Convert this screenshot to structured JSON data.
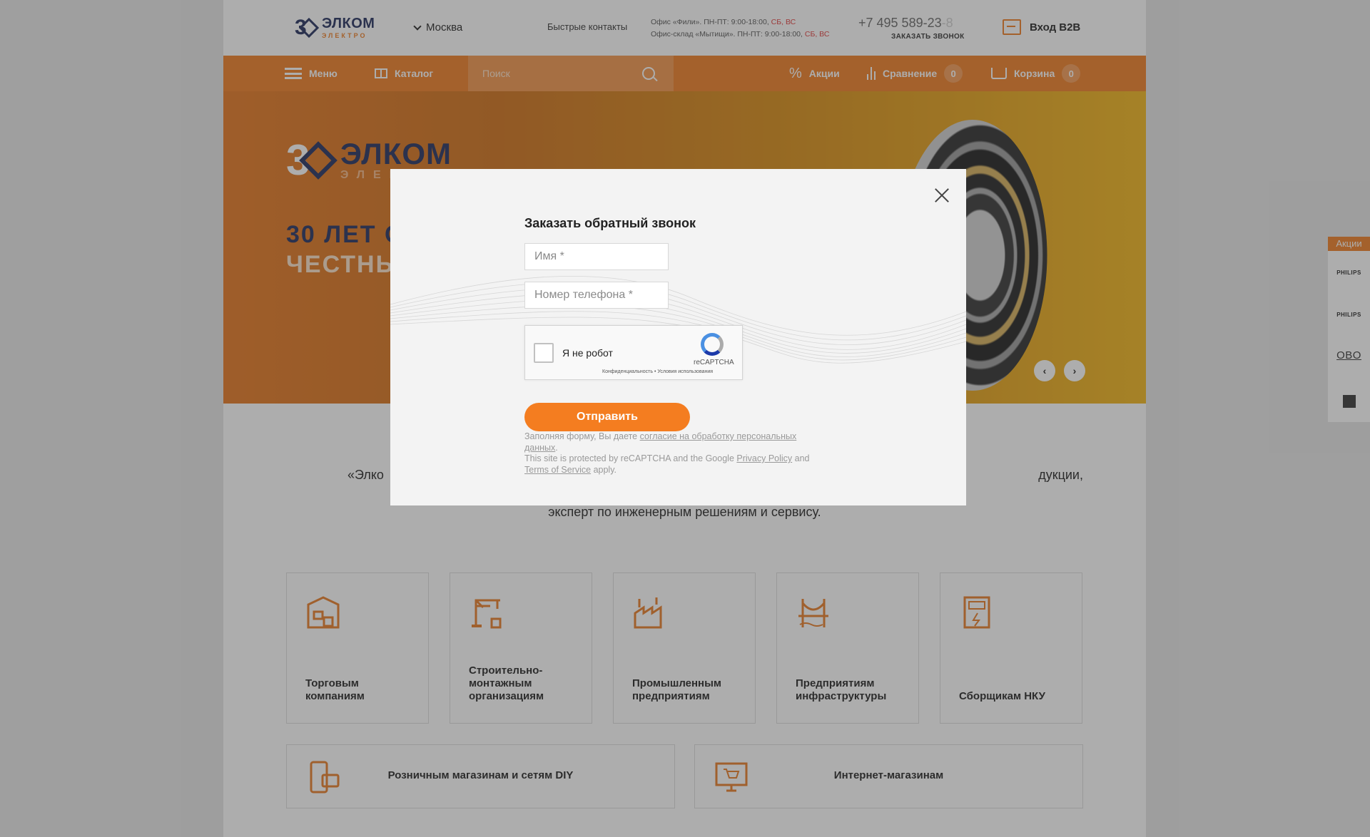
{
  "header": {
    "logo_main": "ЭЛКОМ",
    "logo_sub": "ЭЛЕКТРО",
    "logo_badge_num": "3",
    "city": "Москва",
    "quick_contacts": "Быстрые контакты",
    "office_1": "Офис «Фили». ПН-ПТ: 9:00-18:00,",
    "office_2": "Офис-склад «Мытищи». ПН-ПТ: 9:00-18:00,",
    "weekend": "СБ, ВС",
    "phone": "+7 495 589-23",
    "phone_fade": "-8",
    "callback": "ЗАКАЗАТЬ ЗВОНОК",
    "b2b": "Вход B2B"
  },
  "nav": {
    "menu": "Меню",
    "catalog": "Каталог",
    "search_placeholder": "Поиск",
    "promos": "Акции",
    "compare": "Сравнение",
    "compare_count": "0",
    "cart": "Корзина",
    "cart_count": "0"
  },
  "hero": {
    "logo_main": "ЭЛКОМ",
    "logo_sub": "ЭЛЕКТРО",
    "logo_badge_num": "3",
    "title_line1": "30 ЛЕТ С",
    "title_line2": "ЧЕСТНЫ"
  },
  "intro": {
    "line1_start": "«Элко",
    "line1_end": "дукции,",
    "line2": "эксперт по инженерным решениям и сервису."
  },
  "tiles": [
    {
      "label": "Торговым компаниям"
    },
    {
      "label": "Строительно-монтажным организациям"
    },
    {
      "label": "Промышленным предприятиям"
    },
    {
      "label": "Предприятиям инфраструктуры"
    },
    {
      "label": "Сборщикам НКУ"
    }
  ],
  "wide_tiles": [
    {
      "label": "Розничным магазинам и сетям DIY"
    },
    {
      "label": "Интернет-магазинам"
    }
  ],
  "promo_strip": {
    "label": "Акции",
    "brand1": "PHILIPS",
    "brand2": "PHILIPS",
    "brand3": "OBO"
  },
  "modal": {
    "title": "Заказать обратный звонок",
    "name_placeholder": "Имя *",
    "phone_placeholder": "Номер телефона *",
    "captcha_label": "Я не робот",
    "captcha_brand": "reCAPTCHA",
    "captcha_terms": "Конфиденциальность • Условия использования",
    "submit": "Отправить",
    "notice_1": "Заполняя форму, Вы даете",
    "notice_link": "согласие на обработку персональных данных",
    "notice_2": "This site is protected by reCAPTCHA and the Google",
    "privacy": "Privacy Policy",
    "and": "and",
    "terms": "Terms of Service",
    "apply": "apply."
  },
  "colors": {
    "accent": "#ef7d22",
    "brand_navy": "#1f2c5c"
  }
}
